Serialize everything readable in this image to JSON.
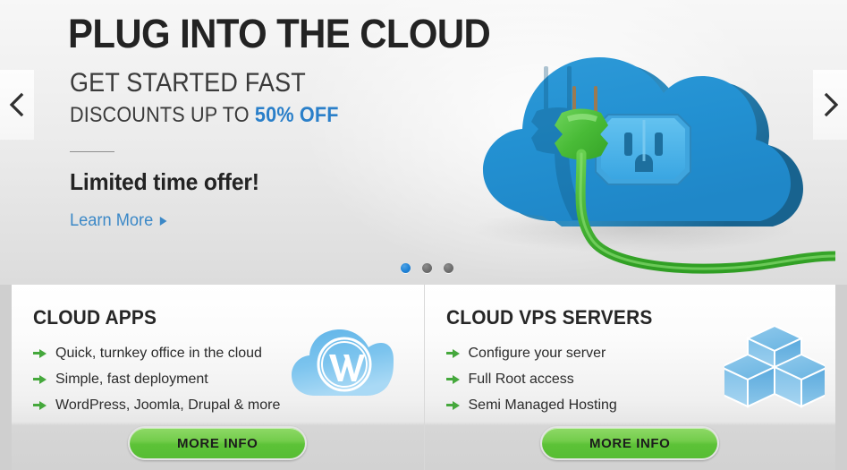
{
  "hero": {
    "title": "PLUG INTO THE CLOUD",
    "subtitle": "GET STARTED FAST",
    "discount_prefix": "DISCOUNTS UP TO",
    "discount_value": "50% OFF",
    "offer": "Limited  time offer!",
    "cta_label": "Learn More",
    "accent_color": "#2a7fc9",
    "prev_icon": "chevron-left-icon",
    "next_icon": "chevron-right-icon",
    "carousel": {
      "dots": [
        {
          "index": 1,
          "active": true
        },
        {
          "index": 2,
          "active": false
        },
        {
          "index": 3,
          "active": false
        }
      ]
    },
    "artwork_name": "cloud-with-power-outlet-and-green-plug"
  },
  "panels": [
    {
      "title": "CLOUD APPS",
      "icon": "wordpress-cloud-icon",
      "features": [
        "Quick, turnkey office in the cloud",
        "Simple, fast deployment",
        "WordPress, Joomla, Drupal & more"
      ],
      "button_label": "MORE INFO",
      "button_color": "#5cc237"
    },
    {
      "title": "CLOUD VPS SERVERS",
      "icon": "stacked-cubes-icon",
      "features": [
        "Configure your server",
        "Full Root access",
        "Semi Managed Hosting"
      ],
      "button_label": "MORE INFO",
      "button_color": "#5cc237"
    }
  ]
}
